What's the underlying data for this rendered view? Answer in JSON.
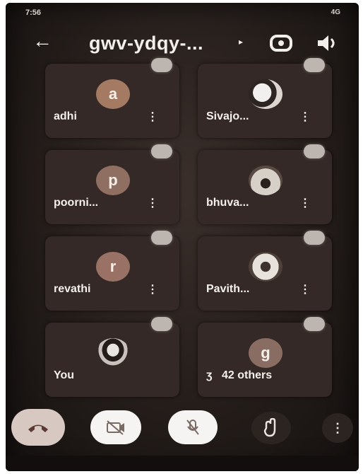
{
  "status": {
    "time": "7:56",
    "icons": "4G"
  },
  "header": {
    "title": "gwv-ydqy-...",
    "caret": "▸"
  },
  "participants": [
    {
      "name": "adhi",
      "initial": "a"
    },
    {
      "name": "Sivajo...",
      "initial": ""
    },
    {
      "name": "poorni...",
      "initial": "p"
    },
    {
      "name": "bhuva...",
      "initial": ""
    },
    {
      "name": "revathi",
      "initial": "r"
    },
    {
      "name": "Pavith...",
      "initial": ""
    },
    {
      "name": "You",
      "initial": ""
    }
  ],
  "others": {
    "initial": "g",
    "label": "42 others",
    "icon": "ʒ"
  },
  "menu_glyph": "⋮",
  "colors": {
    "accent": "#d7c8c2",
    "background": "#241d1a"
  }
}
